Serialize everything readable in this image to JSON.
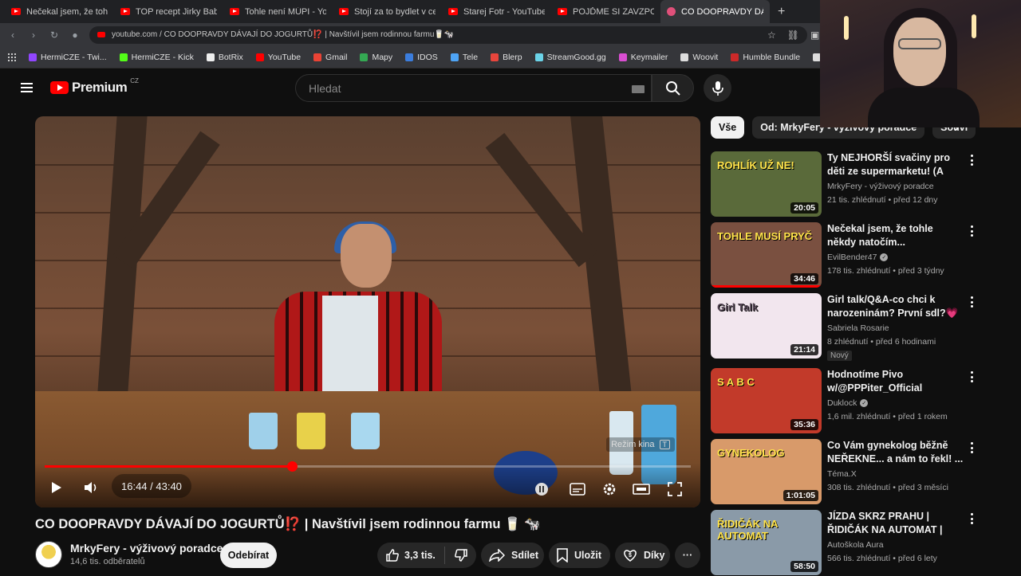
{
  "browser": {
    "tabs": [
      {
        "title": "Nečekal jsem, že tohle ně",
        "active": false
      },
      {
        "title": "TOP recept Jirky Babicii K",
        "active": false
      },
      {
        "title": "Tohle není MÚPI - YouTub",
        "active": false
      },
      {
        "title": "Stojí za to bydlet v centru",
        "active": false
      },
      {
        "title": "Starej Fotr - YouTube",
        "active": false
      },
      {
        "title": "POJĎME SI ZAVZPOMÍNA",
        "active": false
      },
      {
        "title": "CO DOOPRAVDY DÁVAJÍ",
        "active": true
      }
    ],
    "new_tab": "+",
    "url": "youtube.com / CO DOOPRAVDY DÁVAJÍ DO JOGURTŮ⁉️ | Navštívil jsem rodinnou farmu🥛🐄",
    "bookmarks": [
      {
        "label": "HermiCZE - Twi...",
        "color": "#9146ff"
      },
      {
        "label": "HermiCZE - Kick",
        "color": "#53fc18"
      },
      {
        "label": "BotRix",
        "color": "#eeeeee"
      },
      {
        "label": "YouTube",
        "color": "#ff0000"
      },
      {
        "label": "Gmail",
        "color": "#ea4335"
      },
      {
        "label": "Mapy",
        "color": "#34a853"
      },
      {
        "label": "IDOS",
        "color": "#3b7ddd"
      },
      {
        "label": "Tele",
        "color": "#4ea4f6"
      },
      {
        "label": "Blerp",
        "color": "#e8453c"
      },
      {
        "label": "StreamGood.gg",
        "color": "#6bd3e8"
      },
      {
        "label": "Keymailer",
        "color": "#d94ed1"
      },
      {
        "label": "Woovit",
        "color": "#dddddd"
      },
      {
        "label": "Humble Bundle",
        "color": "#cc2929"
      },
      {
        "label": "7TV",
        "color": "#dddddd"
      },
      {
        "label": "Ca",
        "color": "#4285f4"
      }
    ]
  },
  "youtube": {
    "logo_text": "Premium",
    "logo_region": "CZ",
    "search_placeholder": "Hledat",
    "video": {
      "time": "16:44 / 43:40",
      "progress_fraction": 0.383,
      "cinema_label": "Režim kina",
      "cinema_key": "T",
      "title_main": "CO DOOPRAVDY DÁVAJÍ DO JOGURTŮ",
      "title_emoji": "⁉️",
      "title_rest": " | Navštívil jsem rodinnou farmu 🥛 🐄"
    },
    "channel": {
      "name": "MrkyFery - výživový poradce",
      "subscribers": "14,6 tis. odběratelů",
      "subscribe_label": "Odebírat"
    },
    "actions": {
      "likes": "3,3 tis.",
      "share": "Sdílet",
      "save": "Uložit",
      "thanks": "Díky",
      "more": "···"
    },
    "chips": [
      "Vše",
      "Od: MrkyFery - výživový poradce",
      "Souvi"
    ],
    "recommendations": [
      {
        "title": "Ty NEJHORŠÍ svačiny pro děti ze supermarketu! (A nejen pro ...",
        "channel": "MrkyFery - výživový poradce",
        "verified": false,
        "meta": "21 tis. zhlédnutí • před 12 dny",
        "duration": "20:05",
        "thumb_text": "ROHLÍK UŽ NE!",
        "thumb_bg": "#5a6a3a",
        "badge": ""
      },
      {
        "title": "Nečekal jsem, že tohle někdy natočím...",
        "channel": "EvilBender47",
        "verified": true,
        "meta": "178 tis. zhlédnutí • před 3 týdny",
        "duration": "34:46",
        "thumb_text": "TOHLE MUSÍ PRYČ",
        "thumb_bg": "#7a5040",
        "badge": ""
      },
      {
        "title": "Girl talk/Q&A-co chci k narozeninám? První sdl?💗🌟",
        "channel": "Sabriela Rosarie",
        "verified": false,
        "meta": "8 zhlédnutí • před 6 hodinami",
        "duration": "21:14",
        "thumb_text": "Girl Talk",
        "thumb_bg": "#f2e6ee",
        "badge": "Nový"
      },
      {
        "title": "Hodnotíme Pivo w/@PPPiter_Official (TierList)",
        "channel": "Duklock",
        "verified": true,
        "meta": "1,6 mil. zhlédnutí • před 1 rokem",
        "duration": "35:36",
        "thumb_text": "S A B C",
        "thumb_bg": "#c23a2a",
        "badge": ""
      },
      {
        "title": "Co Vám gynekolog běžně NEŘEKNE... a nám to řekl! ...",
        "channel": "Téma.X",
        "verified": false,
        "meta": "308 tis. zhlédnutí • před 3 měsíci",
        "duration": "1:01:05",
        "thumb_text": "GYNEKOLOG",
        "thumb_bg": "#d89a6a",
        "badge": ""
      },
      {
        "title": "JÍZDA SKRZ PRAHU | ŘIDIČÁK NA AUTOMAT | JAK NA ...",
        "channel": "Autoškola Aura",
        "verified": false,
        "meta": "566 tis. zhlédnutí • před 6 lety",
        "duration": "58:50",
        "thumb_text": "ŘIDIČÁK NA AUTOMAT",
        "thumb_bg": "#8a9aa8",
        "badge": ""
      }
    ]
  },
  "colors": {
    "background": "#0f0f0f",
    "accent_red": "#ff0000",
    "subscribe_bg": "#f1f1f1"
  }
}
